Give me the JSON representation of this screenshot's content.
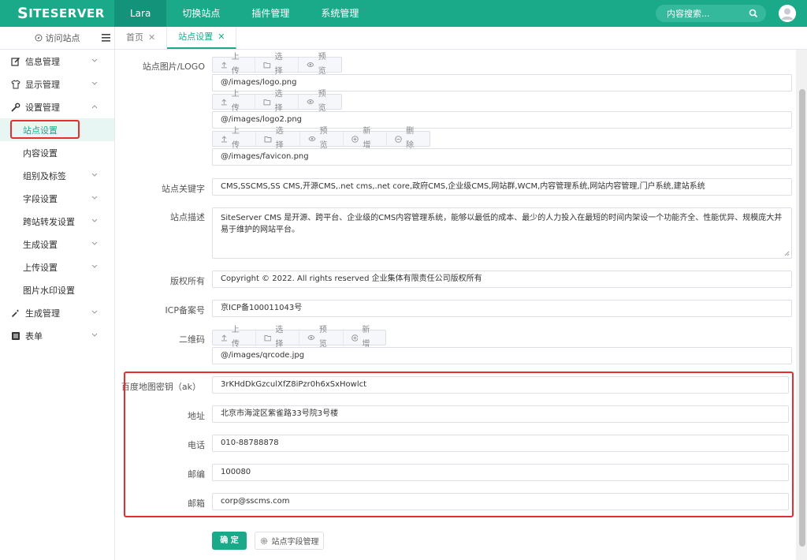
{
  "brand": {
    "logo_big": "S",
    "logo_rest": "ITESERVER"
  },
  "nav": [
    "Lara",
    "切换站点",
    "插件管理",
    "系统管理"
  ],
  "search": {
    "placeholder": "内容搜索..."
  },
  "visit_site": "访问站点",
  "tabs": [
    {
      "label": "首页",
      "close": "✕"
    },
    {
      "label": "站点设置",
      "close": "✕"
    }
  ],
  "sidebar": {
    "items": [
      {
        "label": "信息管理",
        "icon": "edit-icon"
      },
      {
        "label": "显示管理",
        "icon": "shirt-icon"
      },
      {
        "label": "设置管理",
        "icon": "wrench-icon"
      },
      {
        "label": "生成管理",
        "icon": "magic-wand-icon"
      },
      {
        "label": "表单",
        "icon": "list-icon"
      }
    ],
    "sub_items": [
      "站点设置",
      "内容设置",
      "组别及标签",
      "字段设置",
      "跨站转发设置",
      "生成设置",
      "上传设置",
      "图片水印设置"
    ]
  },
  "buttons": {
    "upload": "上传",
    "select": "选择",
    "preview": "预览",
    "add": "新增",
    "delete": "删除"
  },
  "form": {
    "logo_label": "站点图片/LOGO",
    "logo1": "@/images/logo.png",
    "logo2": "@/images/logo2.png",
    "favicon": "@/images/favicon.png",
    "keywords_label": "站点关键字",
    "keywords": "CMS,SSCMS,SS CMS,开源CMS,.net cms,.net core,政府CMS,企业级CMS,网站群,WCM,内容管理系统,网站内容管理,门户系统,建站系统",
    "desc_label": "站点描述",
    "desc": "SiteServer CMS 是开源、跨平台、企业级的CMS内容管理系统，能够以最低的成本、最少的人力投入在最短的时间内架设一个功能齐全、性能优异、规模庞大并易于维护的网站平台。",
    "copyright_label": "版权所有",
    "copyright": "Copyright © 2022. All rights reserved 企业集体有限责任公司版权所有",
    "icp_label": "ICP备案号",
    "icp": "京ICP备100011043号",
    "qrcode_label": "二维码",
    "qrcode": "@/images/qrcode.jpg",
    "baidu_label": "百度地图密钥（ak）",
    "baidu": "3rKHdDkGzculXfZ8iPzr0h6xSxHowlct",
    "address_label": "地址",
    "address": "北京市海淀区紫雀路33号院3号楼",
    "phone_label": "电话",
    "phone": "010-88788878",
    "zip_label": "邮编",
    "zip": "100080",
    "email_label": "邮箱",
    "email": "corp@sscms.com"
  },
  "actions": {
    "submit": "确 定",
    "field_manage": "站点字段管理"
  },
  "colors": {
    "brand": "#1aaa8a",
    "highlight": "#e62e2e"
  }
}
